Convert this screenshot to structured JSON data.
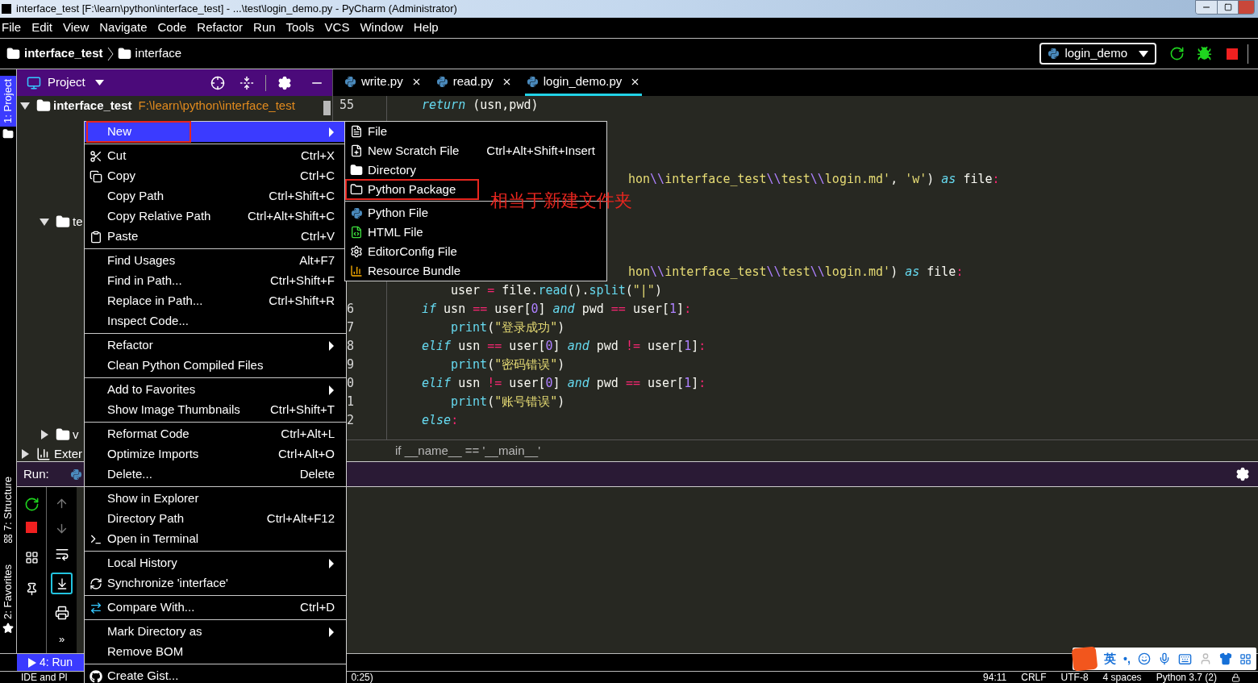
{
  "window": {
    "title": "interface_test [F:\\learn\\python\\interface_test] - ...\\test\\login_demo.py - PyCharm (Administrator)"
  },
  "menu_bar": [
    "File",
    "Edit",
    "View",
    "Navigate",
    "Code",
    "Refactor",
    "Run",
    "Tools",
    "VCS",
    "Window",
    "Help"
  ],
  "breadcrumb": [
    "interface_test",
    "interface"
  ],
  "run_config": "login_demo",
  "side_strip": [
    {
      "label": "1: Project",
      "selected": true
    },
    {
      "label": "7: Structure",
      "selected": false
    },
    {
      "label": "2: Favorites",
      "selected": false
    }
  ],
  "project_panel": {
    "title": "Project",
    "tree": [
      {
        "name": "interface_test",
        "path": "F:\\learn\\python\\interface_test",
        "kind": "folder",
        "expanded": true,
        "children": [
          {
            "name": "te",
            "kind": "folder",
            "expanded": true
          },
          {
            "name": "v",
            "kind": "folder",
            "expanded": false
          }
        ]
      },
      {
        "name": "Exter",
        "kind": "library",
        "expanded": false
      }
    ]
  },
  "tabs": [
    {
      "label": "write.py",
      "selected": false
    },
    {
      "label": "read.py",
      "selected": false
    },
    {
      "label": "login_demo.py",
      "selected": true
    }
  ],
  "code_lines": [
    {
      "kind": "line",
      "number": "55",
      "tokens": [
        {
          "kind": "kw",
          "text": "return"
        },
        {
          "kind": "tx",
          "text": " (usn,pwd)"
        }
      ]
    },
    {
      "kind": "tail",
      "tokens": [
        {
          "kind": "str",
          "text": "hon"
        },
        {
          "kind": "esc",
          "text": "\\\\"
        },
        {
          "kind": "str",
          "text": "interface_test"
        },
        {
          "kind": "esc",
          "text": "\\\\"
        },
        {
          "kind": "str",
          "text": "test"
        },
        {
          "kind": "esc",
          "text": "\\\\"
        },
        {
          "kind": "str",
          "text": "login.md'"
        },
        {
          "kind": "tx",
          "text": ", "
        },
        {
          "kind": "str",
          "text": "'w'"
        },
        {
          "kind": "tx",
          "text": ") "
        },
        {
          "kind": "kw",
          "text": "as"
        },
        {
          "kind": "tx",
          "text": " file"
        },
        {
          "kind": "op",
          "text": ":"
        }
      ]
    },
    {
      "kind": "tail",
      "tokens": [
        {
          "kind": "str",
          "text": "hon"
        },
        {
          "kind": "esc",
          "text": "\\\\"
        },
        {
          "kind": "str",
          "text": "interface_test"
        },
        {
          "kind": "esc",
          "text": "\\\\"
        },
        {
          "kind": "str",
          "text": "test"
        },
        {
          "kind": "esc",
          "text": "\\\\"
        },
        {
          "kind": "str",
          "text": "login.md'"
        },
        {
          "kind": "tx",
          "text": ") "
        },
        {
          "kind": "kw",
          "text": "as"
        },
        {
          "kind": "tx",
          "text": " file"
        },
        {
          "kind": "op",
          "text": ":"
        }
      ],
      "children": [
        {
          "kind": "line",
          "tokens": [
            {
              "kind": "tx",
              "text": "user "
            },
            {
              "kind": "op",
              "text": "="
            },
            {
              "kind": "tx",
              "text": " file."
            },
            {
              "kind": "fn",
              "text": "read"
            },
            {
              "kind": "tx",
              "text": "()."
            },
            {
              "kind": "fn",
              "text": "split"
            },
            {
              "kind": "tx",
              "text": "("
            },
            {
              "kind": "str",
              "text": "\"|\""
            },
            {
              "kind": "tx",
              "text": ")"
            }
          ]
        }
      ]
    },
    {
      "kind": "line",
      "number": "6",
      "tokens": [
        {
          "kind": "kw",
          "text": "if"
        },
        {
          "kind": "tx",
          "text": " usn "
        },
        {
          "kind": "op",
          "text": "=="
        },
        {
          "kind": "tx",
          "text": " user["
        },
        {
          "kind": "num",
          "text": "0"
        },
        {
          "kind": "tx",
          "text": "] "
        },
        {
          "kind": "kw",
          "text": "and"
        },
        {
          "kind": "tx",
          "text": " pwd "
        },
        {
          "kind": "op",
          "text": "=="
        },
        {
          "kind": "tx",
          "text": " user["
        },
        {
          "kind": "num",
          "text": "1"
        },
        {
          "kind": "tx",
          "text": "]"
        },
        {
          "kind": "op",
          "text": ":"
        }
      ],
      "children": [
        {
          "kind": "line",
          "number": "7",
          "tokens": [
            {
              "kind": "fn",
              "text": "print"
            },
            {
              "kind": "tx",
              "text": "("
            },
            {
              "kind": "str",
              "text": "\"登录成功\""
            },
            {
              "kind": "tx",
              "text": ")"
            }
          ]
        }
      ]
    },
    {
      "kind": "line",
      "number": "8",
      "tokens": [
        {
          "kind": "kw",
          "text": "elif"
        },
        {
          "kind": "tx",
          "text": " usn "
        },
        {
          "kind": "op",
          "text": "=="
        },
        {
          "kind": "tx",
          "text": " user["
        },
        {
          "kind": "num",
          "text": "0"
        },
        {
          "kind": "tx",
          "text": "] "
        },
        {
          "kind": "kw",
          "text": "and"
        },
        {
          "kind": "tx",
          "text": " pwd "
        },
        {
          "kind": "op",
          "text": "!="
        },
        {
          "kind": "tx",
          "text": " user["
        },
        {
          "kind": "num",
          "text": "1"
        },
        {
          "kind": "tx",
          "text": "]"
        },
        {
          "kind": "op",
          "text": ":"
        }
      ],
      "children": [
        {
          "kind": "line",
          "number": "9",
          "tokens": [
            {
              "kind": "fn",
              "text": "print"
            },
            {
              "kind": "tx",
              "text": "("
            },
            {
              "kind": "str",
              "text": "\"密码错误\""
            },
            {
              "kind": "tx",
              "text": ")"
            }
          ]
        }
      ]
    },
    {
      "kind": "line",
      "number": "0",
      "tokens": [
        {
          "kind": "kw",
          "text": "elif"
        },
        {
          "kind": "tx",
          "text": " usn "
        },
        {
          "kind": "op",
          "text": "!="
        },
        {
          "kind": "tx",
          "text": " user["
        },
        {
          "kind": "num",
          "text": "0"
        },
        {
          "kind": "tx",
          "text": "] "
        },
        {
          "kind": "kw",
          "text": "and"
        },
        {
          "kind": "tx",
          "text": " pwd "
        },
        {
          "kind": "op",
          "text": "=="
        },
        {
          "kind": "tx",
          "text": " user["
        },
        {
          "kind": "num",
          "text": "1"
        },
        {
          "kind": "tx",
          "text": "]"
        },
        {
          "kind": "op",
          "text": ":"
        }
      ],
      "children": [
        {
          "kind": "line",
          "number": "1",
          "tokens": [
            {
              "kind": "fn",
              "text": "print"
            },
            {
              "kind": "tx",
              "text": "("
            },
            {
              "kind": "str",
              "text": "\"账号错误\""
            },
            {
              "kind": "tx",
              "text": ")"
            }
          ]
        }
      ]
    },
    {
      "kind": "line",
      "number": "2",
      "tokens": [
        {
          "kind": "kw",
          "text": "else"
        },
        {
          "kind": "op",
          "text": ":"
        }
      ]
    }
  ],
  "code_breadcrumb": "if __name__ == '__main__'",
  "run_panel": {
    "title": "Run:",
    "more": "»"
  },
  "bottom_tool": {
    "label": "4: Run",
    "selected": true
  },
  "context_menu": [
    {
      "kind": "item",
      "label": "New",
      "submenu": true,
      "selected": true,
      "annotated": true
    },
    {
      "kind": "separator"
    },
    {
      "kind": "item",
      "label": "Cut",
      "shortcut": "Ctrl+X"
    },
    {
      "kind": "item",
      "label": "Copy",
      "shortcut": "Ctrl+C"
    },
    {
      "kind": "item",
      "label": "Copy Path",
      "shortcut": "Ctrl+Shift+C"
    },
    {
      "kind": "item",
      "label": "Copy Relative Path",
      "shortcut": "Ctrl+Alt+Shift+C"
    },
    {
      "kind": "item",
      "label": "Paste",
      "shortcut": "Ctrl+V"
    },
    {
      "kind": "separator"
    },
    {
      "kind": "item",
      "label": "Find Usages",
      "shortcut": "Alt+F7"
    },
    {
      "kind": "item",
      "label": "Find in Path...",
      "shortcut": "Ctrl+Shift+F"
    },
    {
      "kind": "item",
      "label": "Replace in Path...",
      "shortcut": "Ctrl+Shift+R"
    },
    {
      "kind": "item",
      "label": "Inspect Code..."
    },
    {
      "kind": "separator"
    },
    {
      "kind": "item",
      "label": "Refactor",
      "submenu": true
    },
    {
      "kind": "item",
      "label": "Clean Python Compiled Files"
    },
    {
      "kind": "separator"
    },
    {
      "kind": "item",
      "label": "Add to Favorites",
      "submenu": true
    },
    {
      "kind": "item",
      "label": "Show Image Thumbnails",
      "shortcut": "Ctrl+Shift+T"
    },
    {
      "kind": "separator"
    },
    {
      "kind": "item",
      "label": "Reformat Code",
      "shortcut": "Ctrl+Alt+L"
    },
    {
      "kind": "item",
      "label": "Optimize Imports",
      "shortcut": "Ctrl+Alt+O"
    },
    {
      "kind": "item",
      "label": "Delete...",
      "shortcut": "Delete"
    },
    {
      "kind": "separator"
    },
    {
      "kind": "item",
      "label": "Show in Explorer"
    },
    {
      "kind": "item",
      "label": "Directory Path",
      "shortcut": "Ctrl+Alt+F12"
    },
    {
      "kind": "item",
      "label": "Open in Terminal"
    },
    {
      "kind": "separator"
    },
    {
      "kind": "item",
      "label": "Local History",
      "submenu": true
    },
    {
      "kind": "item",
      "label": "Synchronize 'interface'"
    },
    {
      "kind": "separator"
    },
    {
      "kind": "item",
      "label": "Compare With...",
      "shortcut": "Ctrl+D"
    },
    {
      "kind": "separator"
    },
    {
      "kind": "item",
      "label": "Mark Directory as",
      "submenu": true
    },
    {
      "kind": "item",
      "label": "Remove BOM"
    },
    {
      "kind": "separator"
    },
    {
      "kind": "item",
      "label": "Create Gist..."
    }
  ],
  "new_submenu": [
    {
      "kind": "item",
      "label": "File"
    },
    {
      "kind": "item",
      "label": "New Scratch File",
      "shortcut": "Ctrl+Alt+Shift+Insert"
    },
    {
      "kind": "item",
      "label": "Directory"
    },
    {
      "kind": "item",
      "label": "Python Package",
      "annotated": true
    },
    {
      "kind": "separator"
    },
    {
      "kind": "item",
      "label": "Python File"
    },
    {
      "kind": "item",
      "label": "HTML File"
    },
    {
      "kind": "item",
      "label": "EditorConfig File"
    },
    {
      "kind": "item",
      "label": "Resource Bundle"
    }
  ],
  "annotation": "相当于新建文件夹",
  "ime_bar": {
    "mode": "英",
    "punct": "•,"
  },
  "status_bar": {
    "left": "IDE and Pl",
    "middle": "0:25)",
    "items": [
      "94:11",
      "CRLF",
      "UTF-8",
      "4 spaces",
      "Python 3.7 (2)"
    ]
  }
}
